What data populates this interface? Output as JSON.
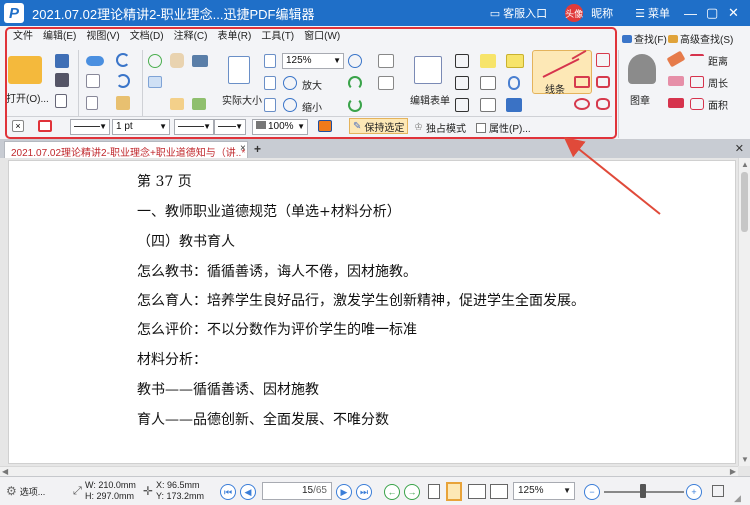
{
  "titlebar": {
    "logo": "P",
    "title": "2021.07.02理论精讲2-职业理念...迅捷PDF编辑器",
    "service": "客服入口",
    "avatar": "头像",
    "nickname": "昵称",
    "menu": "菜单"
  },
  "menubar": [
    "文件",
    "编辑(E)",
    "视图(V)",
    "文档(D)",
    "注释(C)",
    "表单(R)",
    "工具(T)",
    "窗口(W)"
  ],
  "ribbon": {
    "open_label": "打开(O)...",
    "actual_size_label": "实际大小",
    "zoom_value": "125%",
    "zoom_in_label": "放大",
    "zoom_out_label": "缩小",
    "edit_form_label": "编辑表单",
    "line_label": "线条",
    "find_label": "查找(F)",
    "advanced_find_label": "高级查找(S)",
    "stamp_label": "图章",
    "distance_label": "距离",
    "perimeter_label": "周长",
    "area_label": "面积",
    "line_width": "1 pt",
    "opacity": "100%",
    "keep_selected_label": "保持选定",
    "exclusive_mode_label": "独占模式",
    "properties_label": "属性(P)...",
    "accent_color": "#e0333a",
    "active_tool_color": "#fde8b6"
  },
  "tabs": {
    "active_tab": "2021.07.02理论精讲2-职业理念+职业道德知与（讲..*",
    "close": "×",
    "add": "+"
  },
  "document": {
    "lines": [
      "第 37 页",
      "一、教师职业道德规范（单选+材料分析）",
      "（四）教书育人",
      "怎么教书：循循善诱，诲人不倦，因材施教。",
      "怎么育人：培养学生良好品行，激发学生创新精神，促进学生全面发展。",
      "怎么评价：不以分数作为评价学生的唯一标准",
      "材料分析：",
      "教书——循循善诱、因材施教",
      "育人——品德创新、全面发展、不唯分数"
    ]
  },
  "statusbar": {
    "options_label": "选项...",
    "width": "W: 210.0mm",
    "height": "H: 297.0mm",
    "x": "X:   96.5mm",
    "y": "Y: 173.2mm",
    "page_current": "15",
    "page_total": "/65",
    "zoom_value": "125%"
  }
}
